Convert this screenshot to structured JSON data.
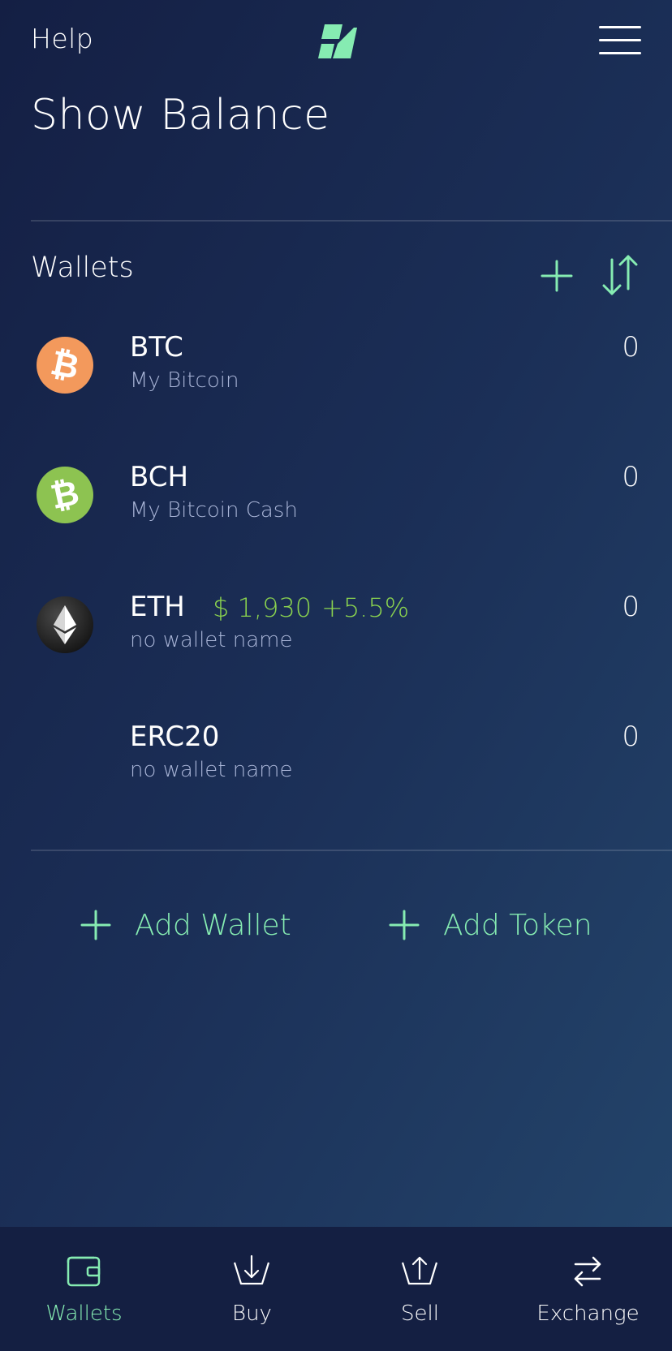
{
  "header": {
    "help_label": "Help",
    "logo_icon": "app-logo-icon",
    "menu_icon": "hamburger-menu-icon",
    "title": "Show Balance"
  },
  "wallets": {
    "title": "Wallets",
    "add_icon": "plus-icon",
    "sort_icon": "sort-arrows-icon",
    "items": [
      {
        "symbol": "BTC",
        "name": "My Bitcoin",
        "balance": "0",
        "icon": "bitcoin-icon",
        "color": "#f7931a"
      },
      {
        "symbol": "BCH",
        "name": "My Bitcoin Cash",
        "balance": "0",
        "icon": "bitcoin-cash-icon",
        "color": "#8dc351"
      },
      {
        "symbol": "ETH",
        "name": "no wallet name",
        "balance": "0",
        "price": "$ 1,930",
        "change": "+5.5%",
        "icon": "ethereum-icon",
        "color": "#1f1f1f"
      },
      {
        "symbol": "ERC20",
        "name": "no wallet name",
        "balance": "0"
      }
    ]
  },
  "actions": {
    "add_wallet": "Add Wallet",
    "add_token": "Add Token"
  },
  "tabs": [
    {
      "label": "Wallets",
      "icon": "wallet-icon",
      "active": true
    },
    {
      "label": "Buy",
      "icon": "basket-down-icon",
      "active": false
    },
    {
      "label": "Sell",
      "icon": "basket-up-icon",
      "active": false
    },
    {
      "label": "Exchange",
      "icon": "exchange-arrows-icon",
      "active": false
    }
  ],
  "colors": {
    "accent": "#86ecb2",
    "price_green": "#8bd44f",
    "muted_text": "#a8b4d6",
    "tabbar_bg": "#141f42"
  }
}
